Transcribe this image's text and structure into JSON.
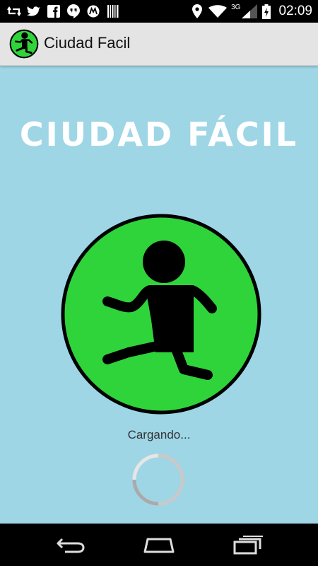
{
  "status_bar": {
    "notifications": [
      "retweet-icon",
      "twitter-icon",
      "facebook-icon",
      "hangouts-icon",
      "motorola-icon",
      "barcode-icon"
    ],
    "network_label": "3G",
    "time": "02:09"
  },
  "action_bar": {
    "title": "Ciudad Facil"
  },
  "splash": {
    "title": "Ciudad Fácil",
    "loading_text": "Cargando...",
    "logo_color": "#2fd43a"
  },
  "nav_bar": {
    "buttons": [
      "back-icon",
      "home-icon",
      "recents-icon"
    ]
  },
  "colors": {
    "background": "#9ed6e6",
    "action_bar": "#e4e4e4",
    "status_bar": "#000000",
    "logo_green": "#2fd43a"
  }
}
